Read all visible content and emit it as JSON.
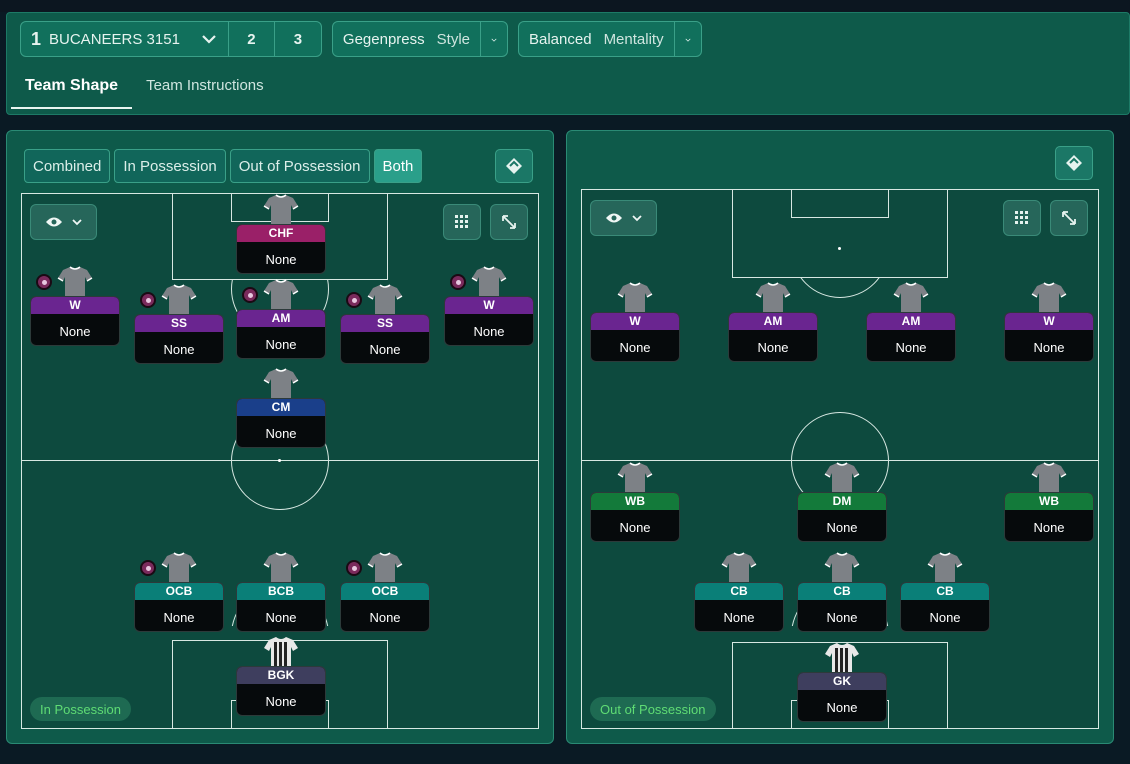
{
  "tactic": {
    "slot_number": "1",
    "name": "BUCANEERS 3151",
    "slot2": "2",
    "slot3": "3",
    "style_value": "Gegenpress",
    "style_label": "Style",
    "mentality_value": "Balanced",
    "mentality_label": "Mentality"
  },
  "tabs": [
    {
      "label": "Team Shape",
      "active": true
    },
    {
      "label": "Team Instructions",
      "active": false
    }
  ],
  "left_panel": {
    "segments": [
      {
        "label": "Combined",
        "active": false
      },
      {
        "label": "In Possession",
        "active": false
      },
      {
        "label": "Out of Possession",
        "active": false
      },
      {
        "label": "Both",
        "active": true
      }
    ],
    "mode_tag": "In Possession",
    "players": [
      {
        "role": "CHF",
        "name": "None",
        "color": "chf"
      },
      {
        "role": "W",
        "name": "None",
        "color": "att",
        "badge": true
      },
      {
        "role": "SS",
        "name": "None",
        "color": "att",
        "badge": true
      },
      {
        "role": "AM",
        "name": "None",
        "color": "att",
        "badge": true
      },
      {
        "role": "SS",
        "name": "None",
        "color": "att",
        "badge": true
      },
      {
        "role": "W",
        "name": "None",
        "color": "att",
        "badge": true
      },
      {
        "role": "CM",
        "name": "None",
        "color": "mid"
      },
      {
        "role": "OCB",
        "name": "None",
        "color": "def",
        "badge": true
      },
      {
        "role": "BCB",
        "name": "None",
        "color": "def"
      },
      {
        "role": "OCB",
        "name": "None",
        "color": "def",
        "badge": true
      },
      {
        "role": "BGK",
        "name": "None",
        "color": "gk"
      }
    ]
  },
  "right_panel": {
    "mode_tag": "Out of Possession",
    "players": [
      {
        "role": "W",
        "name": "None",
        "color": "att"
      },
      {
        "role": "AM",
        "name": "None",
        "color": "att"
      },
      {
        "role": "AM",
        "name": "None",
        "color": "att"
      },
      {
        "role": "W",
        "name": "None",
        "color": "att"
      },
      {
        "role": "WB",
        "name": "None",
        "color": "dm"
      },
      {
        "role": "DM",
        "name": "None",
        "color": "dm"
      },
      {
        "role": "WB",
        "name": "None",
        "color": "dm"
      },
      {
        "role": "CB",
        "name": "None",
        "color": "def"
      },
      {
        "role": "CB",
        "name": "None",
        "color": "def"
      },
      {
        "role": "CB",
        "name": "None",
        "color": "def"
      },
      {
        "role": "GK",
        "name": "None",
        "color": "gk"
      }
    ]
  },
  "icons": {
    "eye": "eye-icon",
    "grid": "grid-icon",
    "expand": "expand-icon",
    "paint": "paint-icon",
    "chevron": "chevron-down-icon"
  },
  "colors": {
    "attack": "#6a2590",
    "chf": "#9a2068",
    "midfield": "#1a3f8a",
    "defence": "#0a7f78",
    "def_mid": "#137a3a",
    "goalkeeper": "#3e3e5e",
    "accent": "#2a9f8a"
  }
}
